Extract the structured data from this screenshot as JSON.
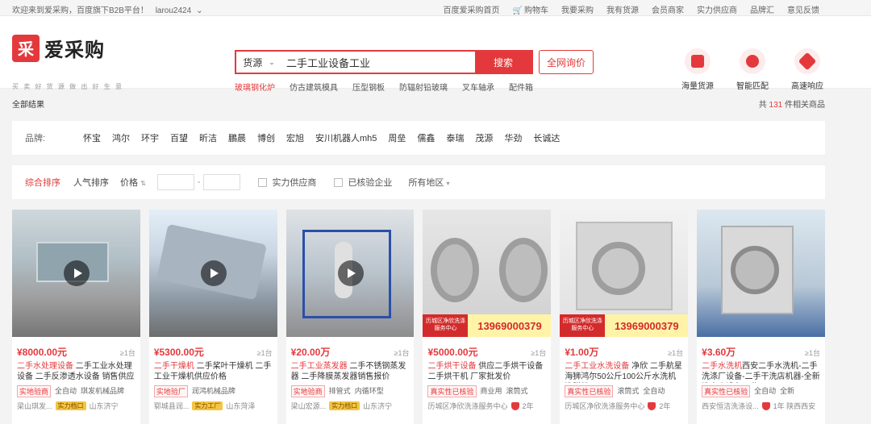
{
  "topbar": {
    "welcome": "欢迎来到爱采购，百度旗下B2B平台！",
    "username": "larou2424",
    "links": [
      "百度爱采购首页",
      "购物车",
      "我要采购",
      "我有货源",
      "会员商家",
      "实力供应商",
      "品牌汇",
      "意见反馈"
    ]
  },
  "header": {
    "logo_mark": "采",
    "logo_text": "爱采购",
    "slogan": "买 卖 好 货 源 做 出 好 生 意",
    "search_type": "货源",
    "search_value": "二手工业设备工业",
    "search_button": "搜索",
    "inquiry_button": "全网询价",
    "hotwords": [
      "玻璃钢化炉",
      "仿古建筑模具",
      "压型钢板",
      "防辐射铅玻璃",
      "叉车轴承",
      "配件箱"
    ],
    "features": [
      "海量货源",
      "智能匹配",
      "高速响应"
    ]
  },
  "results": {
    "label": "全部结果",
    "count_prefix": "共",
    "count": "131",
    "count_suffix": "件相关商品"
  },
  "brands": {
    "label": "品牌:",
    "items": [
      "怀宝",
      "鸿尔",
      "环宇",
      "百望",
      "昕洁",
      "鵬晨",
      "博创",
      "宏旭",
      "安川机器人mh5",
      "周垒",
      "儒鑫",
      "泰瑞",
      "茂源",
      "华劲",
      "长诚达"
    ]
  },
  "sort": {
    "default": "综合排序",
    "popular": "人气排序",
    "price": "价格",
    "dash": "-",
    "strong_supplier": "实力供应商",
    "verified": "已核验企业",
    "region": "所有地区"
  },
  "products": [
    {
      "price": "¥8000.00元",
      "moq": "≥1台",
      "title_hl": "二手水处理设备",
      "title": " 二手工业水处理设备 二手反渗透水设备 销售供应",
      "tags": [
        "实地验商",
        "全自动",
        "琪发机械品牌"
      ],
      "location": "梁山琪发...",
      "badge": "实力档口",
      "city": "山东济宁",
      "video": true,
      "phone": null,
      "banner_text": null
    },
    {
      "price": "¥5300.00元",
      "moq": "≥1台",
      "title_hl": "二手干燥机",
      "title": " 二手桨叶干燥机 二手工业干燥机供应价格",
      "tags": [
        "实地验厂",
        "润鸿机械品牌"
      ],
      "location": "郓城县润...",
      "badge": "实力工厂",
      "city": "山东菏泽",
      "video": true,
      "phone": null,
      "banner_text": null
    },
    {
      "price": "¥20.00万",
      "moq": "≥1台",
      "title_hl": "二手工业蒸发器",
      "title": " 二手不锈钢蒸发器 二手降膜蒸发器销售报价",
      "tags": [
        "实地验商",
        "排管式",
        "内循环型"
      ],
      "location": "梁山宏源...",
      "badge": "实力档口",
      "city": "山东济宁",
      "video": true,
      "phone": null,
      "banner_text": null
    },
    {
      "price": "¥5000.00元",
      "moq": "≥1台",
      "title_hl": "二手烘干设备",
      "title": " 供应二手烘干设备 二手烘干机 厂家批发价",
      "tags": [
        "真实性已核验",
        "商业用",
        "滚筒式"
      ],
      "location": "历城区净欣洗涤服务中心",
      "badge": "",
      "city": "2年",
      "video": false,
      "phone": "13969000379",
      "banner_text": "历城区净欣洗涤服务中心"
    },
    {
      "price": "¥1.00万",
      "moq": "≥1台",
      "title_hl": "二手工业水洗设备",
      "title": " 净欣 二手航星海狮鸿尔50公斤100公斤水洗机洗脱机",
      "tags": [
        "真实性已核验",
        "滚筒式",
        "全自动"
      ],
      "location": "历城区净欣洗涤服务中心",
      "badge": "",
      "city": "2年",
      "video": false,
      "phone": "13969000379",
      "banner_text": "历城区净欣洗涤服务中心"
    },
    {
      "price": "¥3.60万",
      "moq": "≥1台",
      "title_hl": "二手水洗机",
      "title": "西安二手水洗机-二手洗涤厂设备-二手干洗店机器-全新洗衣房设备工业...",
      "tags": [
        "真实性已核验",
        "全自动",
        "全新"
      ],
      "location": "西安恒洁洗涤设...",
      "badge": "",
      "city": "1年  陕西西安",
      "video": false,
      "phone": null,
      "banner_text": null
    }
  ],
  "colors": {
    "accent": "#e4393c"
  }
}
